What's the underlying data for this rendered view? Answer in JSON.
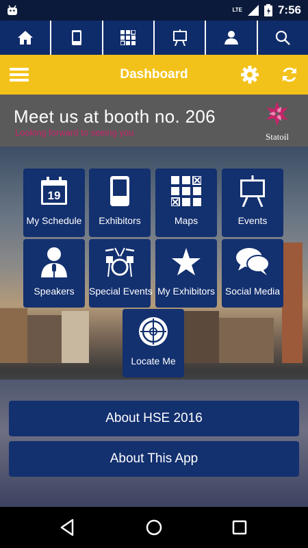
{
  "status_bar": {
    "time": "7:56",
    "network": "LTE"
  },
  "topnav": {
    "items": [
      {
        "icon": "home-icon"
      },
      {
        "icon": "booth-icon"
      },
      {
        "icon": "map-grid-icon"
      },
      {
        "icon": "easel-icon"
      },
      {
        "icon": "speaker-icon"
      },
      {
        "icon": "search-icon"
      }
    ]
  },
  "toolbar": {
    "title": "Dashboard",
    "accent": "#f3c21a"
  },
  "banner": {
    "title": "Meet us at booth no. 206",
    "subtitle": "Looking forward to seeing you",
    "logo_text": "Statoil"
  },
  "tiles": [
    {
      "label": "My Schedule",
      "icon": "calendar-icon",
      "calendar_day": "19"
    },
    {
      "label": "Exhibitors",
      "icon": "booth-icon"
    },
    {
      "label": "Maps",
      "icon": "map-grid-icon"
    },
    {
      "label": "Events",
      "icon": "easel-icon"
    },
    {
      "label": "Speakers",
      "icon": "speaker-icon"
    },
    {
      "label": "Special Events",
      "icon": "drums-icon"
    },
    {
      "label": "My Exhibitors",
      "icon": "star-icon"
    },
    {
      "label": "Social Media",
      "icon": "chat-bubbles-icon"
    },
    {
      "label": "Locate Me",
      "icon": "crosshair-icon"
    }
  ],
  "buttons": {
    "about_event": "About HSE 2016",
    "about_app": "About This App"
  },
  "colors": {
    "navy": "#13306f",
    "topnav": "#0f2c6a",
    "banner_sub": "#c8246a"
  }
}
